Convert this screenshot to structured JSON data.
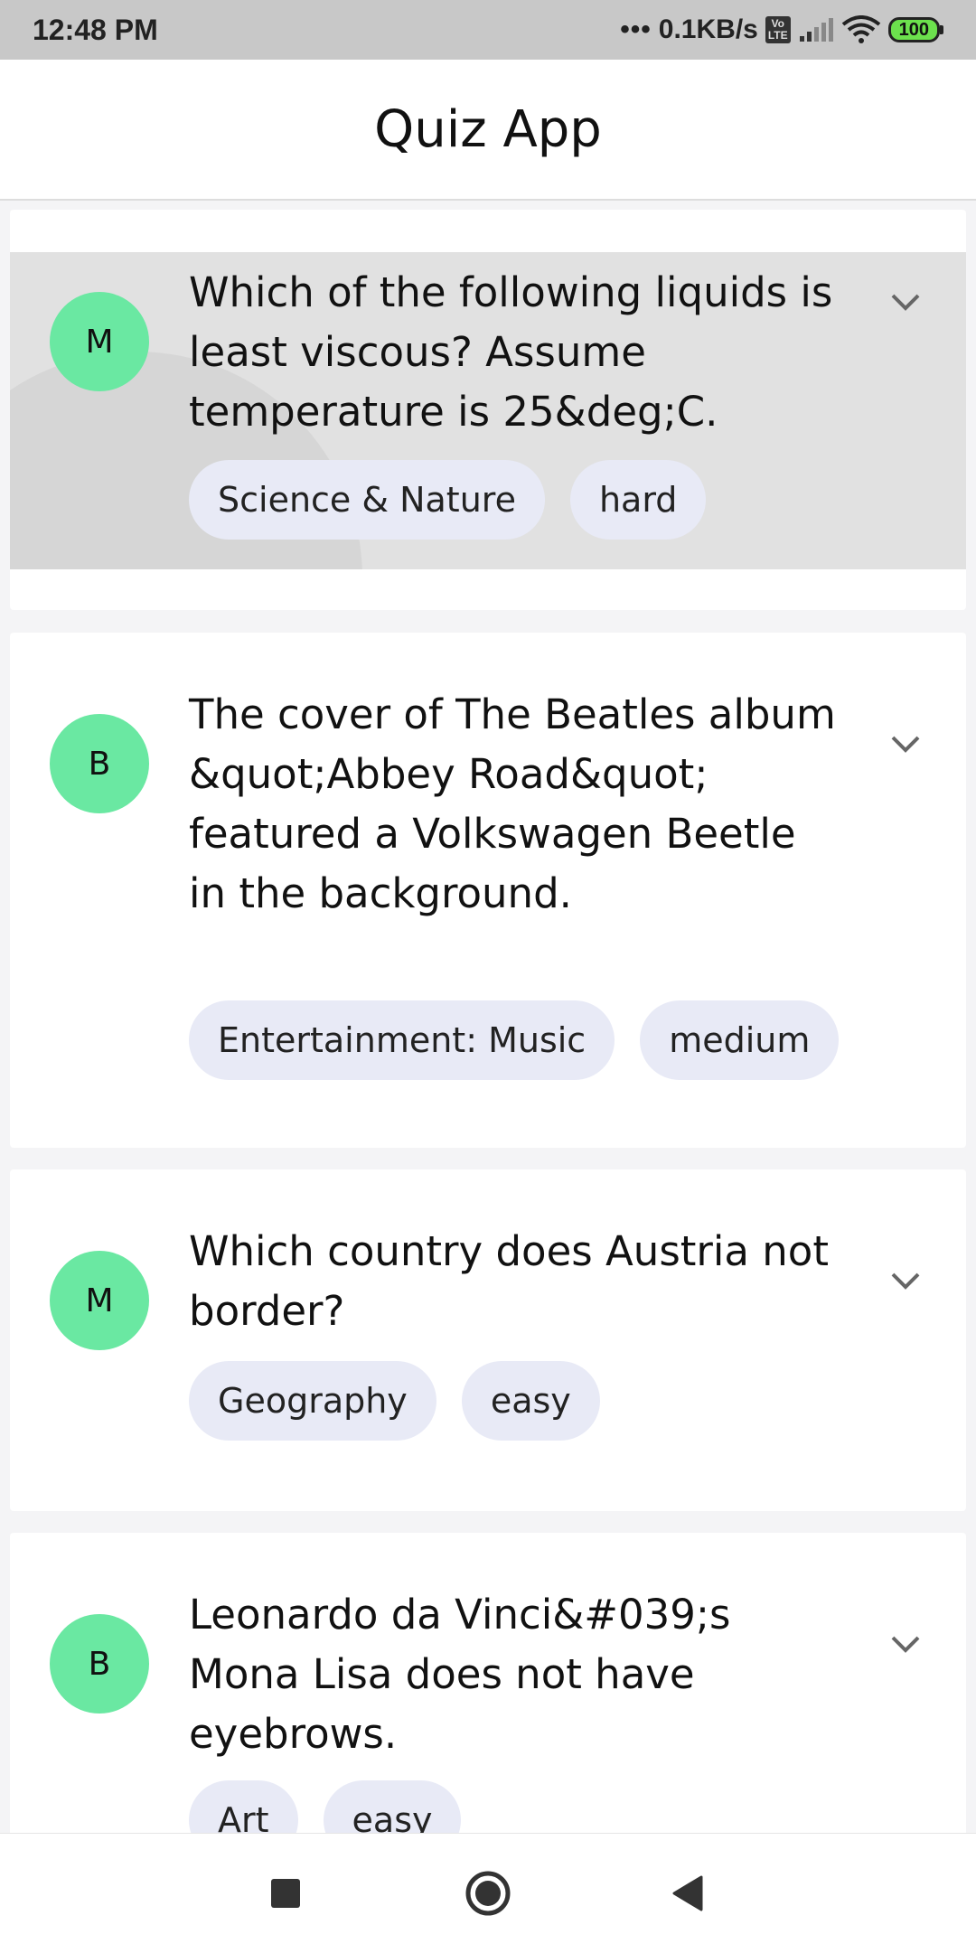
{
  "status_bar": {
    "time": "12:48 PM",
    "network_speed": "0.1KB/s",
    "volte_label": "Vo LTE",
    "battery_level": "100",
    "icons": [
      "signal-dots-icon",
      "volte-icon",
      "cell-signal-icon",
      "wifi-icon",
      "battery-icon"
    ]
  },
  "app_bar": {
    "title": "Quiz App"
  },
  "questions": [
    {
      "avatar_letter": "M",
      "text": "Which of the following liquids is least viscous? Assume temperature is 25&deg;C.",
      "category": "Science & Nature",
      "difficulty": "hard",
      "state": "pressed"
    },
    {
      "avatar_letter": "B",
      "text": "The cover of The Beatles album &quot;Abbey Road&quot; featured a Volkswagen Beetle in the background.",
      "category": "Entertainment: Music",
      "difficulty": "medium"
    },
    {
      "avatar_letter": "M",
      "text": "Which country does Austria not border?",
      "category": "Geography",
      "difficulty": "easy"
    },
    {
      "avatar_letter": "B",
      "text": "Leonardo da Vinci&#039;s Mona Lisa does not have eyebrows.",
      "category": "Art",
      "difficulty": "easy"
    }
  ],
  "nav_bar": {
    "icons": [
      "recents-square-icon",
      "home-circle-icon",
      "back-triangle-icon"
    ]
  },
  "colors": {
    "avatar": "#6ae8a2",
    "chip": "#e8eaf6",
    "pressed_card": "#e1e1e1",
    "status_bar": "#c8c8c8"
  }
}
